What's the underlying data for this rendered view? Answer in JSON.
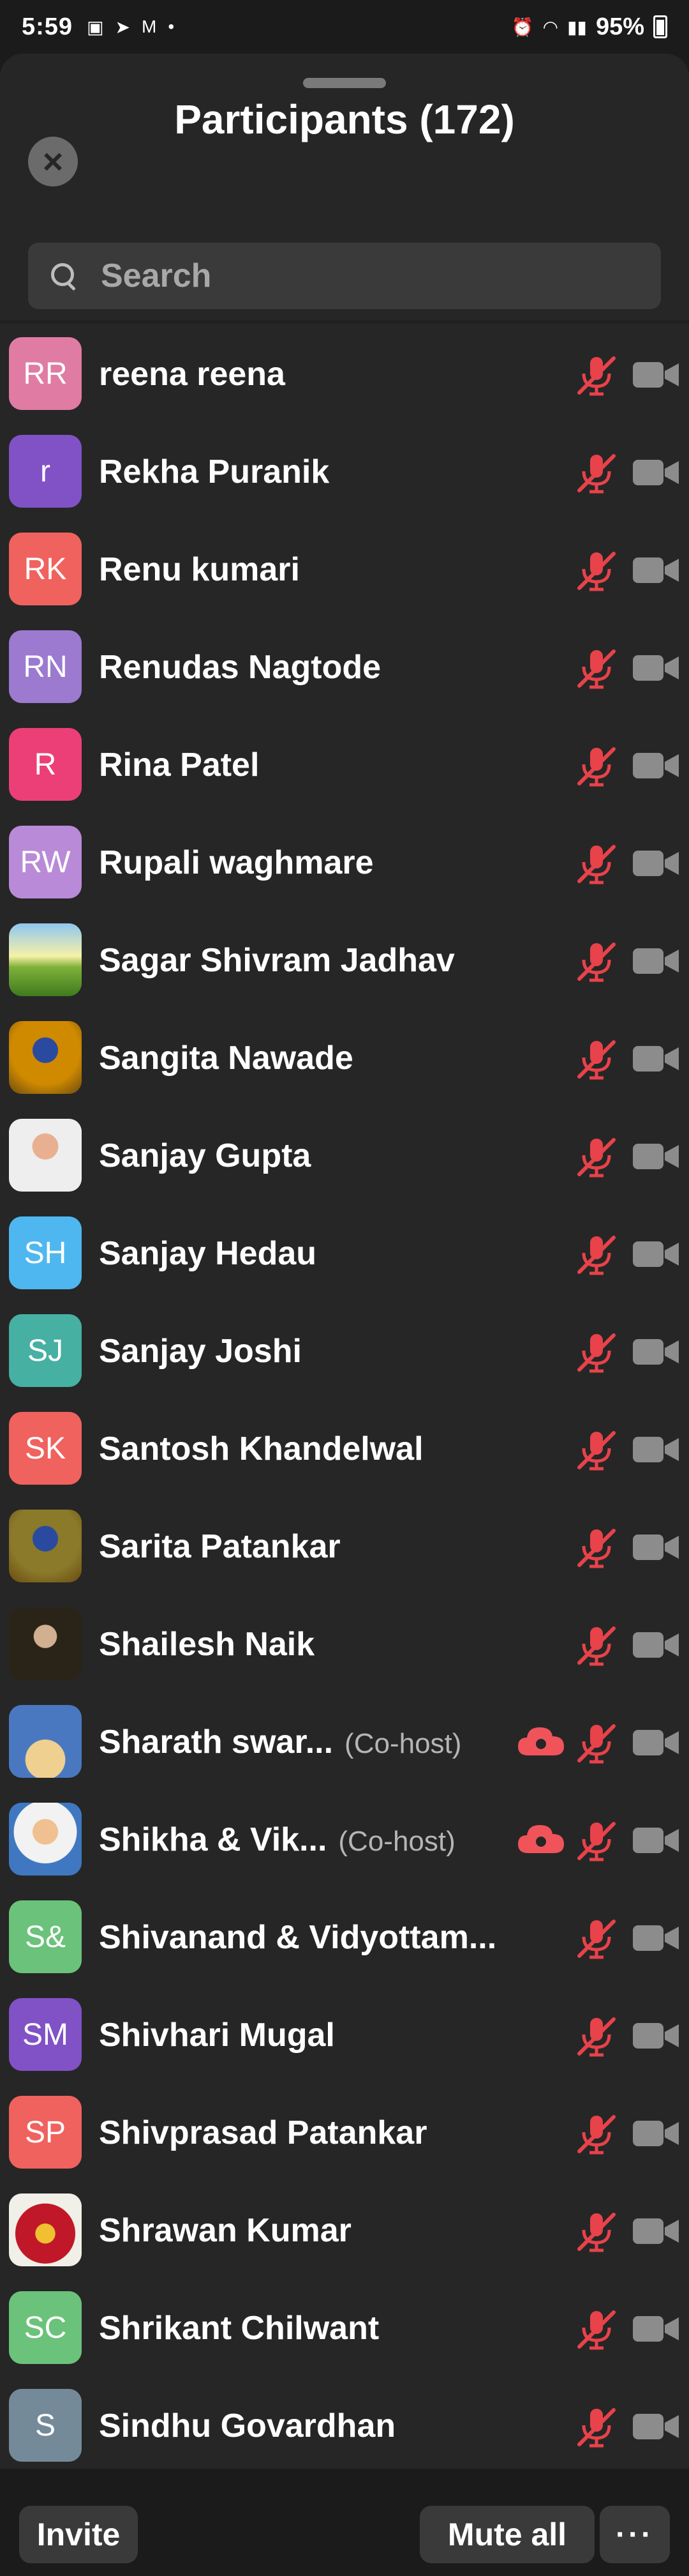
{
  "status": {
    "time": "5:59",
    "battery": "95%",
    "notif_icons": [
      "image-icon",
      "telegram-icon",
      "gmail-icon",
      "dot-icon"
    ],
    "sys_icons": [
      "alarm-icon",
      "wifi-icon",
      "volte-icon",
      "signal-icon"
    ]
  },
  "header": {
    "title": "Participants (172)"
  },
  "search": {
    "placeholder": "Search"
  },
  "participants": [
    {
      "initials": "RR",
      "name": "reena reena",
      "color": "#e07ba4"
    },
    {
      "initials": "r",
      "name": "Rekha Puranik",
      "color": "#8052c6"
    },
    {
      "initials": "RK",
      "name": "Renu kumari",
      "color": "#f0625e"
    },
    {
      "initials": "RN",
      "name": "Renudas Nagtode",
      "color": "#9b7ad0"
    },
    {
      "initials": "R",
      "name": "Rina Patel",
      "color": "#ec3f78"
    },
    {
      "initials": "RW",
      "name": "Rupali waghmare",
      "color": "#b98ad8"
    },
    {
      "initials": "",
      "name": "Sagar Shivram Jadhav",
      "color": "#6c9d2e",
      "photo": "sunrise"
    },
    {
      "initials": "",
      "name": "Sangita Nawade",
      "color": "#d08a00",
      "photo": "logo"
    },
    {
      "initials": "",
      "name": "Sanjay Gupta",
      "color": "#c9a088",
      "photo": "person"
    },
    {
      "initials": "SH",
      "name": "Sanjay Hedau",
      "color": "#4fb7f0"
    },
    {
      "initials": "SJ",
      "name": "Sanjay Joshi",
      "color": "#46b0a2"
    },
    {
      "initials": "SK",
      "name": "Santosh Khandelwal",
      "color": "#f0625e"
    },
    {
      "initials": "",
      "name": "Sarita Patankar",
      "color": "#8a7a2a",
      "photo": "logo"
    },
    {
      "initials": "",
      "name": "Shailesh Naik",
      "color": "#3a3020",
      "photo": "person-dark"
    },
    {
      "initials": "",
      "name": "Sharath swar...",
      "cohost": "(Co-host)",
      "color": "#5a88c8",
      "photo": "sky",
      "recording": true
    },
    {
      "initials": "",
      "name": "Shikha & Vik...",
      "cohost": "(Co-host)",
      "color": "#3f78c0",
      "photo": "person-blue",
      "recording": true
    },
    {
      "initials": "S&",
      "name": "Shivanand & Vidyottam...",
      "color": "#6bc27a"
    },
    {
      "initials": "SM",
      "name": "Shivhari Mugal",
      "color": "#8052c6"
    },
    {
      "initials": "SP",
      "name": "Shivprasad Patankar",
      "color": "#f0625e"
    },
    {
      "initials": "",
      "name": "Shrawan Kumar",
      "color": "#a0202a",
      "photo": "flowers"
    },
    {
      "initials": "SC",
      "name": "Shrikant Chilwant",
      "color": "#6bc27a"
    },
    {
      "initials": "S",
      "name": "Sindhu Govardhan",
      "color": "#748a99"
    }
  ],
  "footer": {
    "invite": "Invite",
    "mute_all": "Mute all",
    "more": "···"
  },
  "colors": {
    "muted_red": "#e8424a",
    "cam_gray": "#8c8c8c",
    "record_red": "#f0545a"
  }
}
